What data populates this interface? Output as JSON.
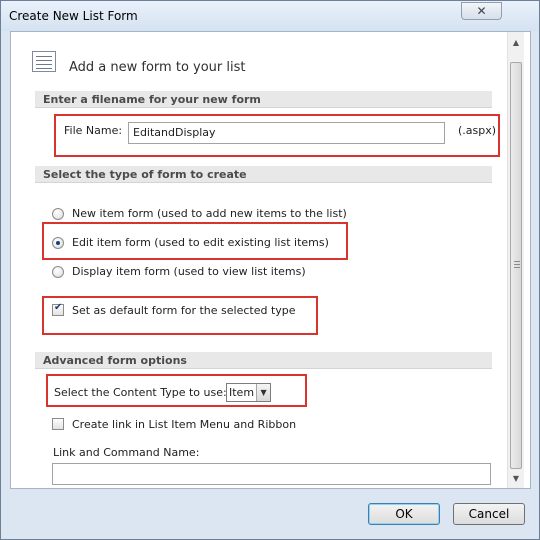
{
  "window": {
    "title": "Create New List Form",
    "close_glyph": "✕"
  },
  "header": {
    "title": "Add a new form to your list"
  },
  "filename_section": {
    "heading": "Enter a filename for your new form",
    "label": "File Name:",
    "value": "EditandDisplay",
    "suffix": "(.aspx)"
  },
  "type_section": {
    "heading": "Select the type of form to create",
    "options": [
      {
        "label": "New item form (used to add new items to the list)",
        "selected": false
      },
      {
        "label": "Edit item form (used to edit existing list items)",
        "selected": true
      },
      {
        "label": "Display item form (used to view list items)",
        "selected": false
      }
    ],
    "default_checkbox": {
      "label": "Set as default form for the selected type",
      "checked": true
    }
  },
  "advanced_section": {
    "heading": "Advanced form options",
    "content_type_label": "Select the Content Type to use:",
    "content_type_value": "Item",
    "create_link_checkbox": {
      "label": "Create link in List Item Menu and Ribbon",
      "checked": false
    },
    "link_name_label": "Link and Command Name:",
    "link_name_value": ""
  },
  "buttons": {
    "ok": "OK",
    "cancel": "Cancel"
  },
  "colors": {
    "highlight": "#d9342b",
    "section_bg": "#e8e8e8",
    "frame": "#dce6f2"
  }
}
